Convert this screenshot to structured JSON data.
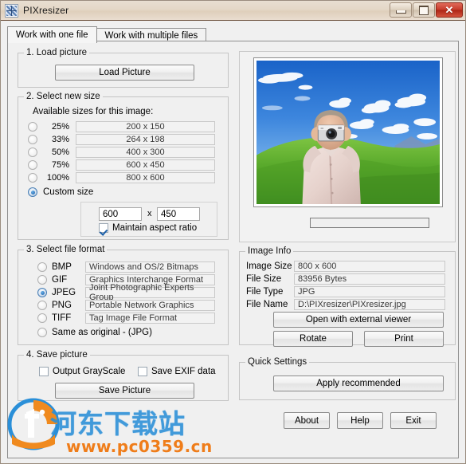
{
  "window": {
    "title": "PIXresizer",
    "icon": "app-grid-icon",
    "minimize_label": "Minimize",
    "maximize_label": "Maximize",
    "close_label": "✕"
  },
  "tabs": [
    {
      "label": "Work with one file",
      "active": true
    },
    {
      "label": "Work with multiple files",
      "active": false
    }
  ],
  "load_picture": {
    "legend": "1. Load picture",
    "button_label": "Load Picture"
  },
  "select_size": {
    "legend": "2. Select new size",
    "available_label": "Available sizes for this image:",
    "options": [
      {
        "percent": "25%",
        "size": "200 x 150",
        "selected": false
      },
      {
        "percent": "33%",
        "size": "264 x 198",
        "selected": false
      },
      {
        "percent": "50%",
        "size": "400 x 300",
        "selected": false
      },
      {
        "percent": "75%",
        "size": "600 x 450",
        "selected": false
      },
      {
        "percent": "100%",
        "size": "800 x 600",
        "selected": false
      }
    ],
    "custom_label": "Custom size",
    "custom_selected": true,
    "custom_width": "600",
    "custom_separator": "x",
    "custom_height": "450",
    "maintain_aspect_label": "Maintain aspect ratio",
    "maintain_aspect_checked": true
  },
  "select_format": {
    "legend": "3. Select file format",
    "options": [
      {
        "name": "BMP",
        "description": "Windows and OS/2 Bitmaps",
        "selected": false
      },
      {
        "name": "GIF",
        "description": "Graphics Interchange Format",
        "selected": false
      },
      {
        "name": "JPEG",
        "description": "Joint Photographic Experts Group",
        "selected": true
      },
      {
        "name": "PNG",
        "description": "Portable Network Graphics",
        "selected": false
      },
      {
        "name": "TIFF",
        "description": "Tag Image File Format",
        "selected": false
      }
    ],
    "same_as_original_label": "Same as original  - (JPG)",
    "same_as_original_selected": false
  },
  "save_picture": {
    "legend": "4. Save picture",
    "grayscale_label": "Output GrayScale",
    "grayscale_checked": false,
    "exif_label": "Save EXIF data",
    "exif_checked": false,
    "save_button_label": "Save Picture"
  },
  "image_info": {
    "legend": "Image Info",
    "rows": [
      {
        "label": "Image Size",
        "value": "800 x 600"
      },
      {
        "label": "File Size",
        "value": "83956 Bytes"
      },
      {
        "label": "File Type",
        "value": "JPG"
      },
      {
        "label": "File Name",
        "value": "D:\\PIXresizer\\PIXresizer.jpg"
      }
    ],
    "open_external_label": "Open with external viewer",
    "rotate_label": "Rotate",
    "print_label": "Print"
  },
  "quick_settings": {
    "legend": "Quick Settings",
    "apply_label": "Apply recommended"
  },
  "footer": {
    "about_label": "About",
    "help_label": "Help",
    "exit_label": "Exit"
  },
  "watermark": {
    "chinese_text": "河东下载站",
    "url_text": "www.pc0359.cn",
    "blue": "#2a8fd8",
    "orange": "#ef7d1a"
  },
  "colors": {
    "accent": "#1b5fa8",
    "titlebar": "#e4d7c7",
    "face": "#f0f0f0"
  }
}
